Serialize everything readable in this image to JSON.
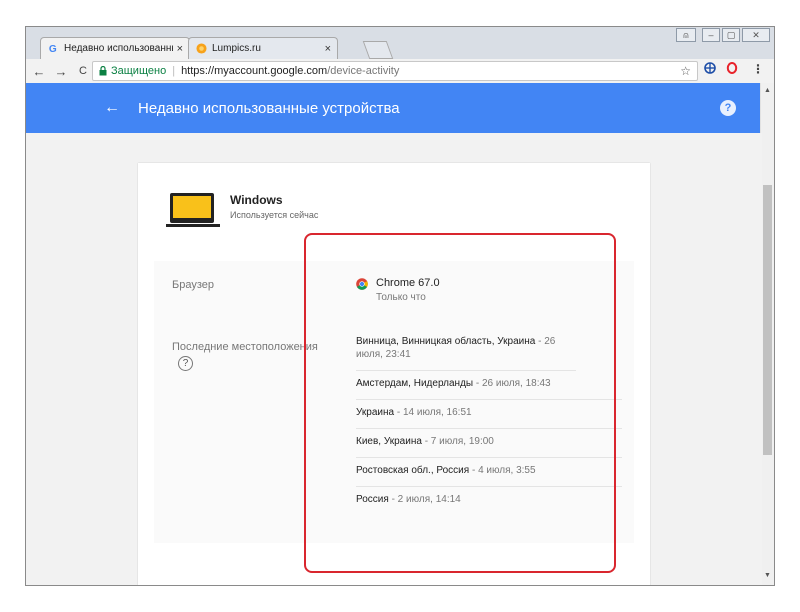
{
  "browser": {
    "tabs": [
      {
        "title": "Недавно использованны",
        "favicon": "google-g-icon",
        "active": true
      },
      {
        "title": "Lumpics.ru",
        "favicon": "lumpics-icon",
        "active": false
      }
    ],
    "tab_close": "×",
    "controls": {
      "user": "⍝",
      "minimize": "–",
      "maximize": "▢",
      "close": "✕"
    },
    "nav": {
      "back": "←",
      "forward": "→",
      "reload": "C"
    },
    "secure_label": "Защищено",
    "url_host": "https://myaccount.google.com",
    "url_path": "/device-activity",
    "bookmark_star": "☆"
  },
  "app": {
    "back_arrow": "←",
    "title": "Недавно использованные устройства",
    "help": "?",
    "accent_color": "#4285f4"
  },
  "device": {
    "name": "Windows",
    "status": "Используется сейчас",
    "browser_label": "Браузер",
    "browser_name": "Chrome 67.0",
    "browser_time": "Только что",
    "locations_label": "Последние местоположения",
    "locations_help": "?",
    "locations": [
      {
        "place": "Винница, Винницкая область, Украина",
        "time": " - 26 июля, 23:41"
      },
      {
        "place": "Амстердам, Нидерланды",
        "time": " - 26 июля, 18:43"
      },
      {
        "place": "Украина",
        "time": " - 14 июля, 16:51"
      },
      {
        "place": "Киев, Украина",
        "time": " - 7 июля, 19:00"
      },
      {
        "place": "Ростовская обл., Россия",
        "time": " - 4 июля, 3:55"
      },
      {
        "place": "Россия",
        "time": " - 2 июля, 14:14"
      }
    ],
    "highlight_color": "#d9262e"
  }
}
